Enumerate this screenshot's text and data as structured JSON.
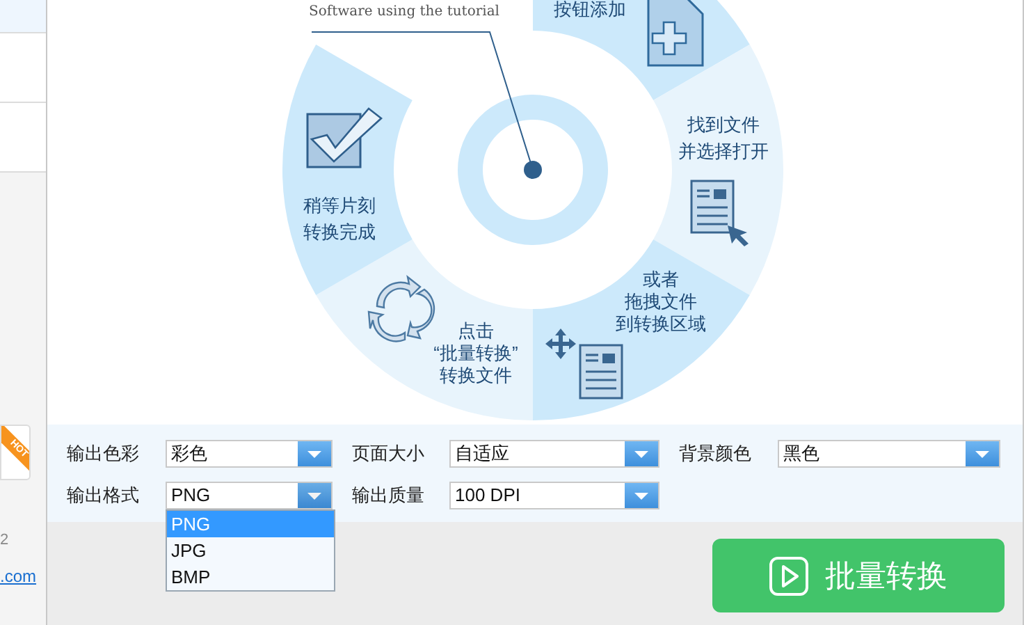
{
  "sidebar": {
    "badge": "HOT",
    "note": "2",
    "link": ".com"
  },
  "diagram": {
    "caption": "Software using the tutorial",
    "steps": [
      {
        "kind": "add",
        "lines": [
          "按钮添加"
        ]
      },
      {
        "kind": "open",
        "lines": [
          "找到文件",
          "并选择打开"
        ]
      },
      {
        "kind": "drag",
        "lines": [
          "或者",
          "拖拽文件",
          "到转换区域"
        ]
      },
      {
        "kind": "convert",
        "lines": [
          "点击",
          "“批量转换”",
          "转换文件"
        ]
      },
      {
        "kind": "done",
        "lines": [
          "稍等片刻",
          "转换完成"
        ]
      }
    ]
  },
  "settings": {
    "rows": [
      [
        {
          "label": "输出色彩",
          "value": "彩色"
        },
        {
          "label": "页面大小",
          "value": "自适应"
        },
        {
          "label": "背景颜色",
          "value": "黑色"
        }
      ],
      [
        {
          "label": "输出格式",
          "value": "PNG",
          "expanded": true,
          "options": [
            {
              "label": "PNG",
              "selected": true
            },
            {
              "label": "JPG",
              "selected": false
            },
            {
              "label": "BMP",
              "selected": false
            }
          ]
        },
        {
          "label": "输出质量",
          "value": "100 DPI",
          "expanded": false
        }
      ]
    ]
  },
  "convert_button": {
    "label": "批量转换"
  }
}
